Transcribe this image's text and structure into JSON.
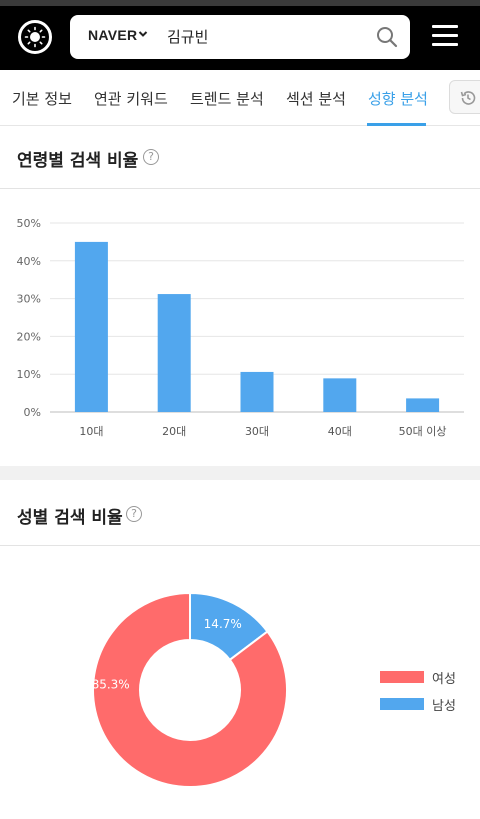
{
  "header": {
    "engine": "NAVER",
    "query": "김규빈",
    "logo_icon": "sun-logo-icon",
    "search_icon": "search-icon",
    "menu_icon": "hamburger-menu-icon"
  },
  "tabs": [
    {
      "label": "기본 정보",
      "active": false
    },
    {
      "label": "연관 키워드",
      "active": false
    },
    {
      "label": "트렌드 분석",
      "active": false
    },
    {
      "label": "섹션 분석",
      "active": false
    },
    {
      "label": "성향 분석",
      "active": true
    }
  ],
  "history_icon": "history-icon",
  "age_section": {
    "title": "연령별 검색 비율",
    "help": "?"
  },
  "gender_section": {
    "title": "성별 검색 비율",
    "help": "?"
  },
  "colors": {
    "accent": "#3aa0e8",
    "bar": "#52a7ee",
    "female": "#ff6b6b",
    "male": "#52a7ee"
  },
  "chart_data": [
    {
      "type": "bar",
      "categories": [
        "10대",
        "20대",
        "30대",
        "40대",
        "50대 이상"
      ],
      "values": [
        45.0,
        31.2,
        10.6,
        8.9,
        3.6
      ],
      "ylim": [
        0,
        50
      ],
      "yticks": [
        "0%",
        "10%",
        "20%",
        "30%",
        "40%",
        "50%"
      ],
      "ytick_values": [
        0,
        10,
        20,
        30,
        40,
        50
      ],
      "grid": true
    },
    {
      "type": "pie",
      "donut": true,
      "slices": [
        {
          "name": "남성",
          "value": 14.7,
          "label": "14.7%"
        },
        {
          "name": "여성",
          "value": 85.3,
          "label": "85.3%"
        }
      ],
      "legend": [
        "여성",
        "남성"
      ],
      "legend_position": "right"
    }
  ]
}
